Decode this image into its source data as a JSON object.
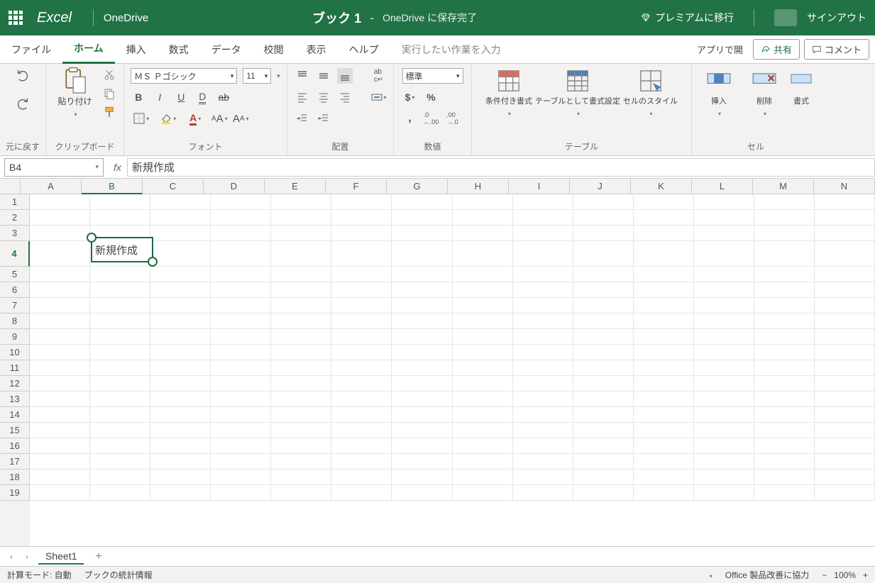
{
  "titlebar": {
    "app": "Excel",
    "location": "OneDrive",
    "doc": "ブック 1",
    "savedTo": "OneDrive に保存完了",
    "premium": "プレミアムに移行",
    "signout": "サインアウト"
  },
  "tabs": {
    "file": "ファイル",
    "home": "ホーム",
    "insert": "挿入",
    "formulas": "数式",
    "data": "データ",
    "review": "校閲",
    "view": "表示",
    "help": "ヘルプ",
    "tellme": "実行したい作業を入力",
    "openapp": "アプリで開",
    "share": "共有",
    "comment": "コメント"
  },
  "ribbon": {
    "undo": "元に戻す",
    "clipboard": {
      "paste": "貼り付け",
      "label": "クリップボード"
    },
    "font": {
      "family": "ＭＳ Ｐゴシック",
      "size": "11",
      "label": "フォント"
    },
    "align": {
      "label": "配置"
    },
    "number": {
      "format": "標準",
      "label": "数値"
    },
    "table": {
      "cond": "条件付き書式",
      "fmt": "テーブルとして書式設定",
      "style": "セルのスタイル",
      "label": "テーブル"
    },
    "cells": {
      "insert": "挿入",
      "delete": "削除",
      "format": "書式",
      "label": "セル"
    }
  },
  "formula": {
    "cell": "B4",
    "value": "新規作成"
  },
  "grid": {
    "cols": [
      "A",
      "B",
      "C",
      "D",
      "E",
      "F",
      "G",
      "H",
      "I",
      "J",
      "K",
      "L",
      "M",
      "N"
    ],
    "rows": [
      "1",
      "2",
      "3",
      "4",
      "5",
      "6",
      "7",
      "8",
      "9",
      "10",
      "11",
      "12",
      "13",
      "14",
      "15",
      "16",
      "17",
      "18",
      "19"
    ],
    "activeCell": {
      "row": 4,
      "col": "B",
      "value": "新規作成"
    }
  },
  "sheet": {
    "name": "Sheet1"
  },
  "status": {
    "calcmode": "計算モード: 自動",
    "stats": "ブックの統計情報",
    "feedback": "Office 製品改善に協力",
    "zoom": "100%"
  }
}
